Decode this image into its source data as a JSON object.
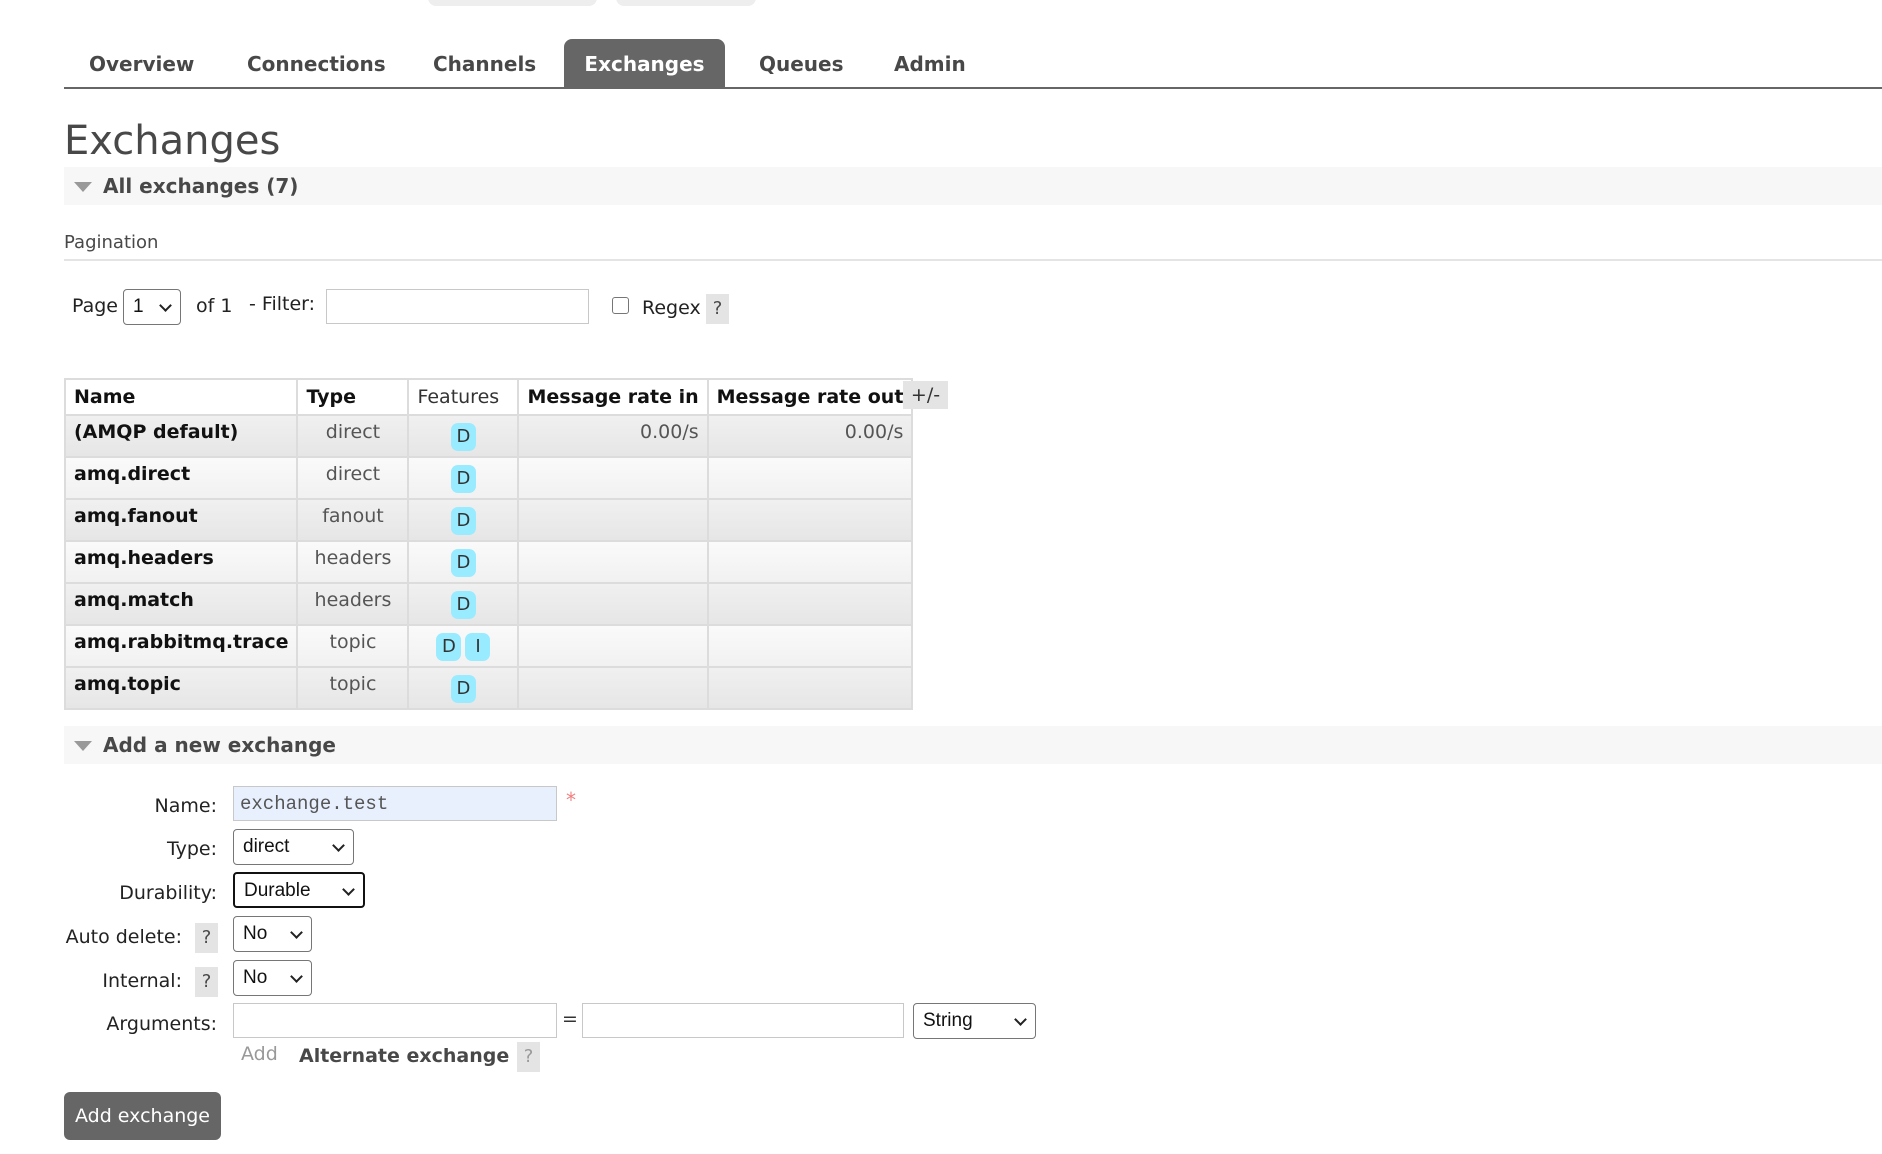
{
  "nav": {
    "tabs": [
      {
        "label": "Overview",
        "active": false
      },
      {
        "label": "Connections",
        "active": false
      },
      {
        "label": "Channels",
        "active": false
      },
      {
        "label": "Exchanges",
        "active": true
      },
      {
        "label": "Queues",
        "active": false
      },
      {
        "label": "Admin",
        "active": false
      }
    ]
  },
  "page": {
    "title": "Exchanges"
  },
  "all_exchanges": {
    "title": "All exchanges (7)",
    "pagination_label": "Pagination",
    "page_label": "Page",
    "page_value": "1",
    "of_label": "of 1",
    "filter_label": "- Filter:",
    "filter_value": "",
    "regex_label": "Regex",
    "regex_checked": false,
    "help": "?",
    "columns_toggle": "+/-",
    "table": {
      "headers": [
        "Name",
        "Type",
        "Features",
        "Message rate in",
        "Message rate out"
      ],
      "rows": [
        {
          "name": "(AMQP default)",
          "type": "direct",
          "features": [
            "D"
          ],
          "rate_in": "0.00/s",
          "rate_out": "0.00/s"
        },
        {
          "name": "amq.direct",
          "type": "direct",
          "features": [
            "D"
          ],
          "rate_in": "",
          "rate_out": ""
        },
        {
          "name": "amq.fanout",
          "type": "fanout",
          "features": [
            "D"
          ],
          "rate_in": "",
          "rate_out": ""
        },
        {
          "name": "amq.headers",
          "type": "headers",
          "features": [
            "D"
          ],
          "rate_in": "",
          "rate_out": ""
        },
        {
          "name": "amq.match",
          "type": "headers",
          "features": [
            "D"
          ],
          "rate_in": "",
          "rate_out": ""
        },
        {
          "name": "amq.rabbitmq.trace",
          "type": "topic",
          "features": [
            "D",
            "I"
          ],
          "rate_in": "",
          "rate_out": ""
        },
        {
          "name": "amq.topic",
          "type": "topic",
          "features": [
            "D"
          ],
          "rate_in": "",
          "rate_out": ""
        }
      ]
    }
  },
  "add_exchange": {
    "title": "Add a new exchange",
    "name_label": "Name:",
    "name_value": "exchange.test",
    "required_mark": "*",
    "type_label": "Type:",
    "type_value": "direct",
    "durability_label": "Durability:",
    "durability_value": "Durable",
    "auto_delete_label": "Auto delete:",
    "auto_delete_value": "No",
    "internal_label": "Internal:",
    "internal_value": "No",
    "arguments_label": "Arguments:",
    "arg_key_value": "",
    "equals": "=",
    "arg_value_value": "",
    "arg_type_value": "String",
    "add_arg_label": "Add",
    "alternate_exchange_label": "Alternate exchange",
    "help": "?",
    "submit_label": "Add exchange"
  },
  "colors": {
    "active_tab_bg": "#666666",
    "feature_badge": "#99ebff",
    "name_input_bg": "#e8f0fe",
    "required_mark": "#f08080"
  }
}
